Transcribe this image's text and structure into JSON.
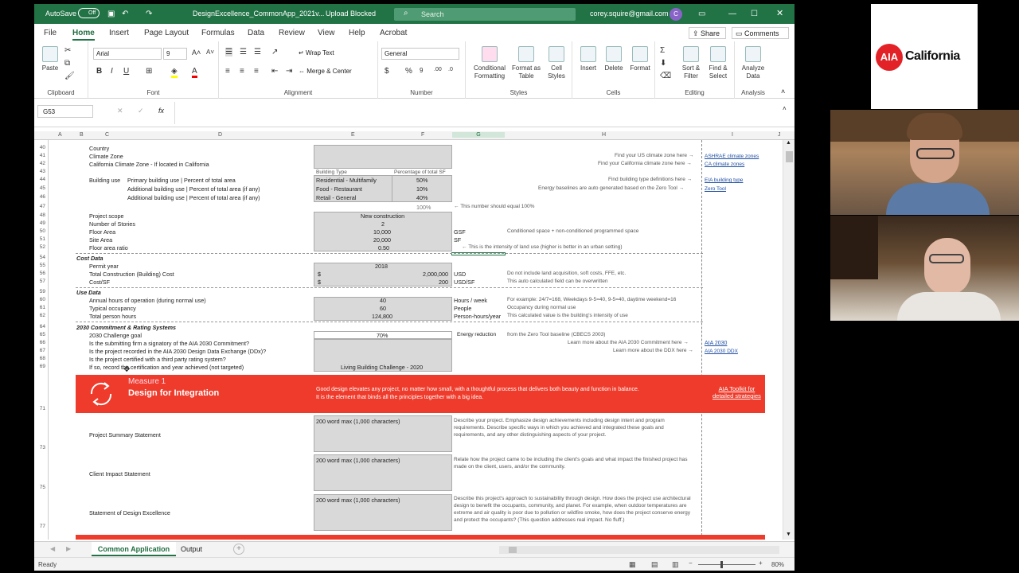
{
  "titlebar": {
    "autosave": "AutoSave",
    "autosave_state": "Off",
    "filename": "DesignExcellence_CommonApp_2021v...",
    "status": "Upload Blocked",
    "search": "Search",
    "user": "corey.squire@gmail.com",
    "avatar": "C"
  },
  "menu": {
    "items": [
      "File",
      "Home",
      "Insert",
      "Page Layout",
      "Formulas",
      "Data",
      "Review",
      "View",
      "Help",
      "Acrobat"
    ],
    "share": "Share",
    "comments": "Comments"
  },
  "ribbon": {
    "paste": "Paste",
    "clipboard": "Clipboard",
    "font_name": "Arial",
    "font_size": "9",
    "font": "Font",
    "wrap": "Wrap Text",
    "merge": "Merge & Center",
    "alignment": "Alignment",
    "number_format": "General",
    "number": "Number",
    "cond": "Conditional Formatting",
    "fmt_table": "Format as Table",
    "cell_styles": "Cell Styles",
    "styles": "Styles",
    "insert": "Insert",
    "delete": "Delete",
    "format": "Format",
    "cells": "Cells",
    "sort": "Sort & Filter",
    "find": "Find & Select",
    "editing": "Editing",
    "analyze": "Analyze Data",
    "analysis": "Analysis"
  },
  "formula": {
    "namebox": "G53",
    "fx": "fx"
  },
  "columns": [
    "A",
    "B",
    "C",
    "D",
    "E",
    "F",
    "G",
    "H",
    "I",
    "J"
  ],
  "rows": {
    "r40": "Country",
    "r41": "Climate Zone",
    "r42": "California Climate Zone - If located in California",
    "r43e": "Building Type",
    "r43f": "Percentage of total SF",
    "r44c": "Building use",
    "r44d": "Primary building use | Percent of total area",
    "r44e": "Residential - Multifamily",
    "r44f": "50%",
    "r45d": "Additional building use | Percent of total area (if any)",
    "r45e": "Food - Restaurant",
    "r45f": "10%",
    "r46d": "Additional building use | Percent of total area (if any)",
    "r46e": "Retail - General",
    "r46f": "40%",
    "r47f": "100%",
    "r47g": "← This number should equal 100%",
    "r48": "Project scope",
    "r48e": "New construction",
    "r49": "Number of Stories",
    "r49e": "2",
    "r50": "Floor Area",
    "r50e": "10,000",
    "r50g": "GSF",
    "r50h": "Conditioned space + non-conditioned programmed space",
    "r51": "Site Area",
    "r51e": "20,000",
    "r51g": "SF",
    "r52": "Floor area ratio",
    "r52e": "0.50",
    "r52g": "← This is the intensity of land use (higher is better in an urban setting)",
    "r54": "Cost Data",
    "r55": "Permit year",
    "r55e": "2018",
    "r56": "Total Construction (Building) Cost",
    "r56s": "$",
    "r56e": "2,000,000",
    "r56g": "USD",
    "r56h": "Do not include land acquisition, soft costs, FFE, etc.",
    "r57": "Cost/SF",
    "r57s": "$",
    "r57e": "200",
    "r57g": "USD/SF",
    "r57h": "This auto calculated field can be overwritten",
    "r59": "Use Data",
    "r60": "Annual hours of operation (during normal use)",
    "r60e": "40",
    "r60g": "Hours / week",
    "r60h": "For example: 24/7=168, Weekdays 9-5=40, 9-5=40, daytime weekend=16",
    "r61": "Typical occupancy",
    "r61e": "60",
    "r61g": "People",
    "r61h": "Occupancy during normal use",
    "r62": "Total person hours",
    "r62e": "124,800",
    "r62g": "Person-hours/year",
    "r62h": "This calculated value is the building's intensity of use",
    "r64": "2030 Commitment & Rating Systems",
    "r65": "2030 Challenge goal",
    "r65e": "70%",
    "r65g": "Energy reduction",
    "r65h": "from the Zero Tool baseline (CBECS 2003)",
    "r66": "Is the submitting firm a signatory of the AIA 2030 Commitment?",
    "r66h": "Learn more about the AIA 2030 Commitment here →",
    "r66i": "AIA 2030",
    "r67": "Is the project recorded in the AIA 2030 Design Data Exchange (DDx)?",
    "r67h": "Learn more about the DDX here →",
    "r67i": "AIA 2030 DDX",
    "r68": "Is the project certified with a third party rating system?",
    "r69": "If so, record the certification and year achieved (not targeted)",
    "r69e": "Living Building Challenge - 2020",
    "h40": "Find your US climate zone here →",
    "i40": "ASHRAE climate zones",
    "h41": "Find your California climate zone here →",
    "i41": "CA climate zones",
    "h44": "Find building type definitions here →",
    "i44": "EIA building type",
    "h45": "Energy baselines are auto generated based on the Zero Tool →",
    "i45": "Zero Tool"
  },
  "measure": {
    "num": "Measure 1",
    "title": "Design for Integration",
    "desc1": "Good design elevates any project, no matter how small, with a thoughtful process that delivers both beauty and function in balance.",
    "desc2": "It is the element that binds all the principles together with a big idea.",
    "link1": "AIA Toolkit for",
    "link2": "detailed strategies"
  },
  "statements": [
    {
      "label": "Project Summary Statement",
      "box": "200 word max (1,000 characters)",
      "help": "Describe your project. Emphasize design achievements including design intent and program requirements. Describe specific ways in which you achieved and integrated these goals and requirements, and any other distinguishing aspects of your project."
    },
    {
      "label": "Client Impact Statement",
      "box": "200 word max (1,000 characters)",
      "help": "Relate how the project came to be including the client's goals and what impact the finished project has made on the client, users, and/or the community."
    },
    {
      "label": "Statement of Design Excellence",
      "box": "200 word max (1,000 characters)",
      "help": "Describe this project's approach to sustainability through design. How does the project use architectural design to benefit the occupants, community, and planet. For example, when outdoor temperatures are extreme and air quality is poor due to pollution or wildfire smoke, how does the project conserve energy and protect the occupants? (This question addresses real impact. No fluff.)"
    }
  ],
  "rownums_bottom": [
    "71",
    "73",
    "75",
    "77"
  ],
  "tabs": {
    "active": "Common Application",
    "other": "Output"
  },
  "status": {
    "ready": "Ready",
    "zoom": "80%"
  },
  "video": {
    "logo_mark": "AIA",
    "logo_text": "California"
  }
}
